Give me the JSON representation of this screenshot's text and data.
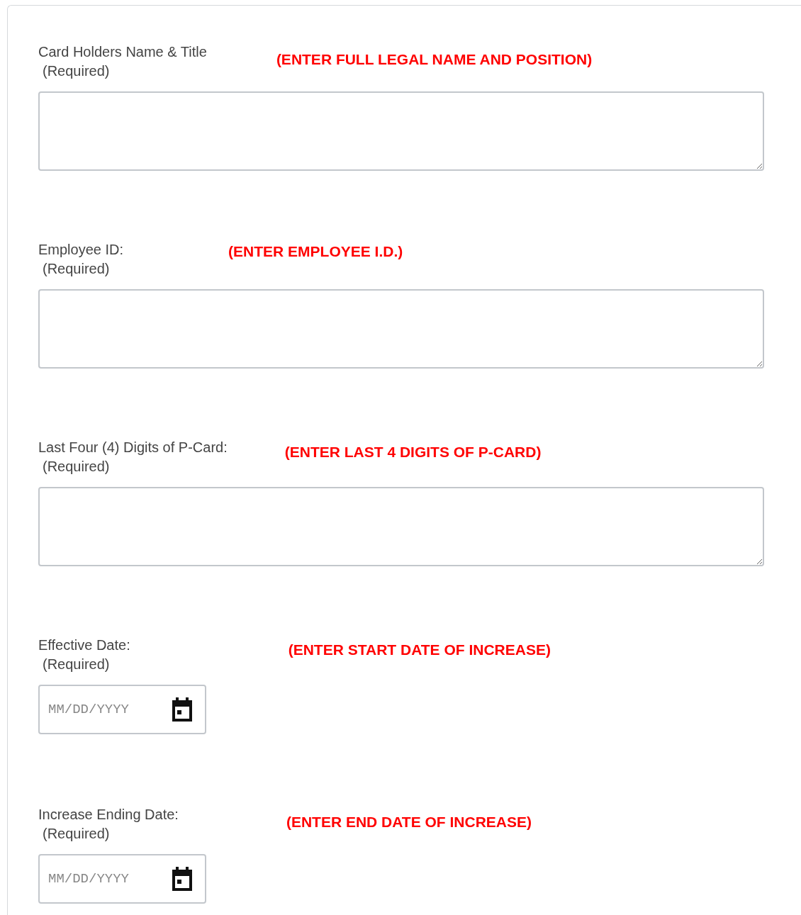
{
  "fields": [
    {
      "kind": "textarea",
      "label": "Card Holders Name & Title",
      "required": "(Required)",
      "hint": "(ENTER FULL LEGAL NAME AND POSITION)"
    },
    {
      "kind": "textarea",
      "label": "Employee ID:",
      "required": "(Required)",
      "hint": "(ENTER EMPLOYEE I.D.)"
    },
    {
      "kind": "textarea",
      "label": "Last Four (4) Digits of P-Card:",
      "required": "(Required)",
      "hint": "(ENTER LAST 4 DIGITS OF P-CARD)"
    },
    {
      "kind": "date",
      "label": "Effective Date:",
      "required": "(Required)",
      "hint": "(ENTER START DATE OF INCREASE)",
      "placeholder": "MM/DD/YYYY"
    },
    {
      "kind": "date",
      "label": "Increase Ending Date:",
      "required": "(Required)",
      "hint": "(ENTER END DATE OF INCREASE)",
      "placeholder": "MM/DD/YYYY"
    }
  ]
}
